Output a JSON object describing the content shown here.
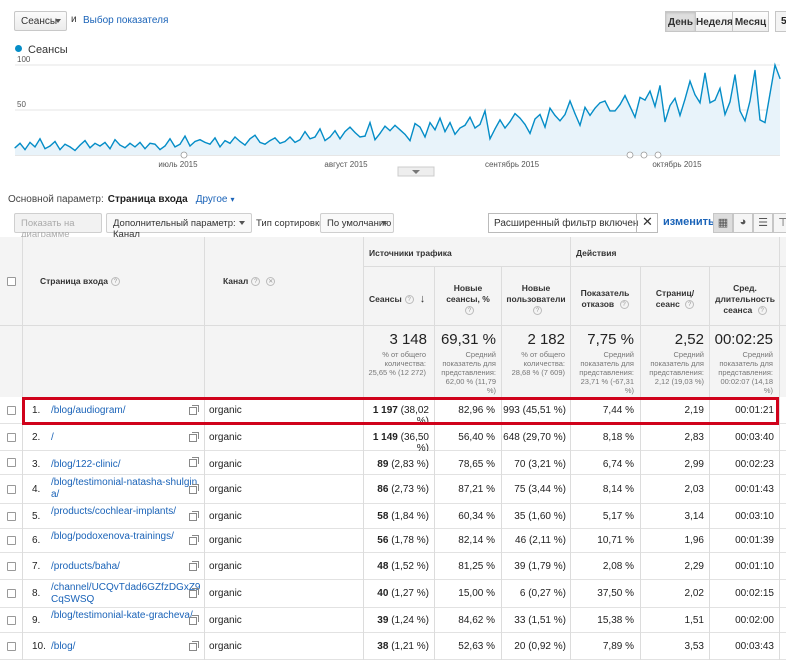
{
  "toolbar": {
    "metric_select": "Сеансы",
    "and_label": "и",
    "metric_link": "Выбор показателя",
    "periods": [
      "День",
      "Неделя",
      "Месяц"
    ],
    "edge_btn": "5"
  },
  "legend": {
    "series_name": "Сеансы",
    "color": "#058dc7"
  },
  "chart_data": {
    "type": "area",
    "y_ticks": [
      100,
      50
    ],
    "ylim": [
      0,
      100
    ],
    "x_labels": [
      "июль 2015",
      "август 2015",
      "сентябрь 2015",
      "октябрь 2015"
    ],
    "series": [
      {
        "name": "Сеансы",
        "values": [
          8,
          13,
          6,
          14,
          9,
          18,
          7,
          10,
          15,
          6,
          12,
          9,
          5,
          11,
          16,
          8,
          13,
          10,
          14,
          7,
          17,
          11,
          8,
          13,
          9,
          14,
          7,
          13,
          12,
          6,
          10,
          18,
          9,
          12,
          21,
          10,
          15,
          17,
          14,
          12,
          19,
          9,
          16,
          13,
          20,
          15,
          11,
          18,
          22,
          14,
          12,
          16,
          19,
          13,
          15,
          20,
          14,
          17,
          26,
          18,
          20,
          29,
          16,
          20,
          27,
          18,
          26,
          31,
          25,
          20,
          21,
          36,
          17,
          24,
          32,
          27,
          33,
          28,
          23,
          16,
          35,
          31,
          20,
          36,
          28,
          41,
          26,
          36,
          23,
          30,
          33,
          42,
          30,
          34,
          49,
          18,
          29,
          39,
          30,
          37,
          46,
          41,
          34,
          24,
          40,
          45,
          31,
          52,
          44,
          38,
          45,
          60,
          46,
          33,
          53,
          44,
          52,
          58,
          60,
          49,
          49,
          56,
          66,
          54,
          42,
          64,
          61,
          71,
          54,
          77,
          37,
          55,
          63,
          44,
          62,
          82,
          67,
          58,
          91,
          58,
          61,
          74,
          45,
          59,
          89,
          49,
          38,
          60,
          94,
          39,
          36,
          68,
          100,
          85
        ]
      }
    ]
  },
  "primary_dim": {
    "label": "Основной параметр:",
    "value": "Страница входа",
    "other": "Другое"
  },
  "table_toolbar": {
    "show_on_chart": "Показать на диаграмме",
    "secondary_dim": "Дополнительный параметр: Канал",
    "sort_label": "Тип сортировки:",
    "sort_value": "По умолчанию",
    "filter": "Расширенный фильтр включен",
    "filter_clear": "✕",
    "change": "изменить"
  },
  "headers": {
    "group_traffic": "Источники трафика",
    "group_actions": "Действия",
    "landing_page": "Страница входа",
    "channel": "Канал",
    "sessions": "Сеансы",
    "new_sessions": "Новые сеансы, %",
    "new_users": "Новые пользователи",
    "bounce": "Показатель отказов",
    "pages_per_session": "Страниц/сеанс",
    "avg_duration": "Сред. длительность сеанса"
  },
  "totals": {
    "sessions": "3 148",
    "sessions_sub": "% от общего количества: 25,65 % (12 272)",
    "new_sessions": "69,31 %",
    "new_sessions_sub": "Средний показатель для представления: 62,00 % (11,79 %)",
    "new_users": "2 182",
    "new_users_sub": "% от общего количества: 28,68 % (7 609)",
    "bounce": "7,75 %",
    "bounce_sub": "Средний показатель для представления: 23,71 % (-67,31 %)",
    "pages": "2,52",
    "pages_sub": "Средний показатель для представления: 2,12 (19,03 %)",
    "duration": "00:02:25",
    "duration_sub": "Средний показатель для представления: 00:02:07 (14,18 %)"
  },
  "rows": [
    {
      "n": "1.",
      "page": "/blog/audiogram/",
      "channel": "organic",
      "sessions": "1 197",
      "sessions_pct": "(38,02 %)",
      "new_sessions": "82,96 %",
      "new_users": "993",
      "new_users_pct": "(45,51 %)",
      "bounce": "7,44 %",
      "pages": "2,19",
      "duration": "00:01:21"
    },
    {
      "n": "2.",
      "page": "/",
      "channel": "organic",
      "sessions": "1 149",
      "sessions_pct": "(36,50 %)",
      "new_sessions": "56,40 %",
      "new_users": "648",
      "new_users_pct": "(29,70 %)",
      "bounce": "8,18 %",
      "pages": "2,83",
      "duration": "00:03:40"
    },
    {
      "n": "3.",
      "page": "/blog/122-clinic/",
      "channel": "organic",
      "sessions": "89",
      "sessions_pct": "(2,83 %)",
      "new_sessions": "78,65 %",
      "new_users": "70",
      "new_users_pct": "(3,21 %)",
      "bounce": "6,74 %",
      "pages": "2,99",
      "duration": "00:02:23"
    },
    {
      "n": "4.",
      "page": "/blog/testimonial-natasha-shulgina/",
      "channel": "organic",
      "sessions": "86",
      "sessions_pct": "(2,73 %)",
      "new_sessions": "87,21 %",
      "new_users": "75",
      "new_users_pct": "(3,44 %)",
      "bounce": "8,14 %",
      "pages": "2,03",
      "duration": "00:01:43"
    },
    {
      "n": "5.",
      "page": "/products/cochlear-implants/",
      "channel": "organic",
      "sessions": "58",
      "sessions_pct": "(1,84 %)",
      "new_sessions": "60,34 %",
      "new_users": "35",
      "new_users_pct": "(1,60 %)",
      "bounce": "5,17 %",
      "pages": "3,14",
      "duration": "00:03:10"
    },
    {
      "n": "6.",
      "page": "/blog/podoxenova-trainings/",
      "channel": "organic",
      "sessions": "56",
      "sessions_pct": "(1,78 %)",
      "new_sessions": "82,14 %",
      "new_users": "46",
      "new_users_pct": "(2,11 %)",
      "bounce": "10,71 %",
      "pages": "1,96",
      "duration": "00:01:39"
    },
    {
      "n": "7.",
      "page": "/products/baha/",
      "channel": "organic",
      "sessions": "48",
      "sessions_pct": "(1,52 %)",
      "new_sessions": "81,25 %",
      "new_users": "39",
      "new_users_pct": "(1,79 %)",
      "bounce": "2,08 %",
      "pages": "2,29",
      "duration": "00:01:10"
    },
    {
      "n": "8.",
      "page": "/channel/UCQvTdad6GZfzDGxZ9CqSWSQ",
      "channel": "organic",
      "sessions": "40",
      "sessions_pct": "(1,27 %)",
      "new_sessions": "15,00 %",
      "new_users": "6",
      "new_users_pct": "(0,27 %)",
      "bounce": "37,50 %",
      "pages": "2,02",
      "duration": "00:02:15"
    },
    {
      "n": "9.",
      "page": "/blog/testimonial-kate-gracheva/",
      "channel": "organic",
      "sessions": "39",
      "sessions_pct": "(1,24 %)",
      "new_sessions": "84,62 %",
      "new_users": "33",
      "new_users_pct": "(1,51 %)",
      "bounce": "15,38 %",
      "pages": "1,51",
      "duration": "00:02:00"
    },
    {
      "n": "10.",
      "page": "/blog/",
      "channel": "organic",
      "sessions": "38",
      "sessions_pct": "(1,21 %)",
      "new_sessions": "52,63 %",
      "new_users": "20",
      "new_users_pct": "(0,92 %)",
      "bounce": "7,89 %",
      "pages": "3,53",
      "duration": "00:03:43"
    }
  ]
}
